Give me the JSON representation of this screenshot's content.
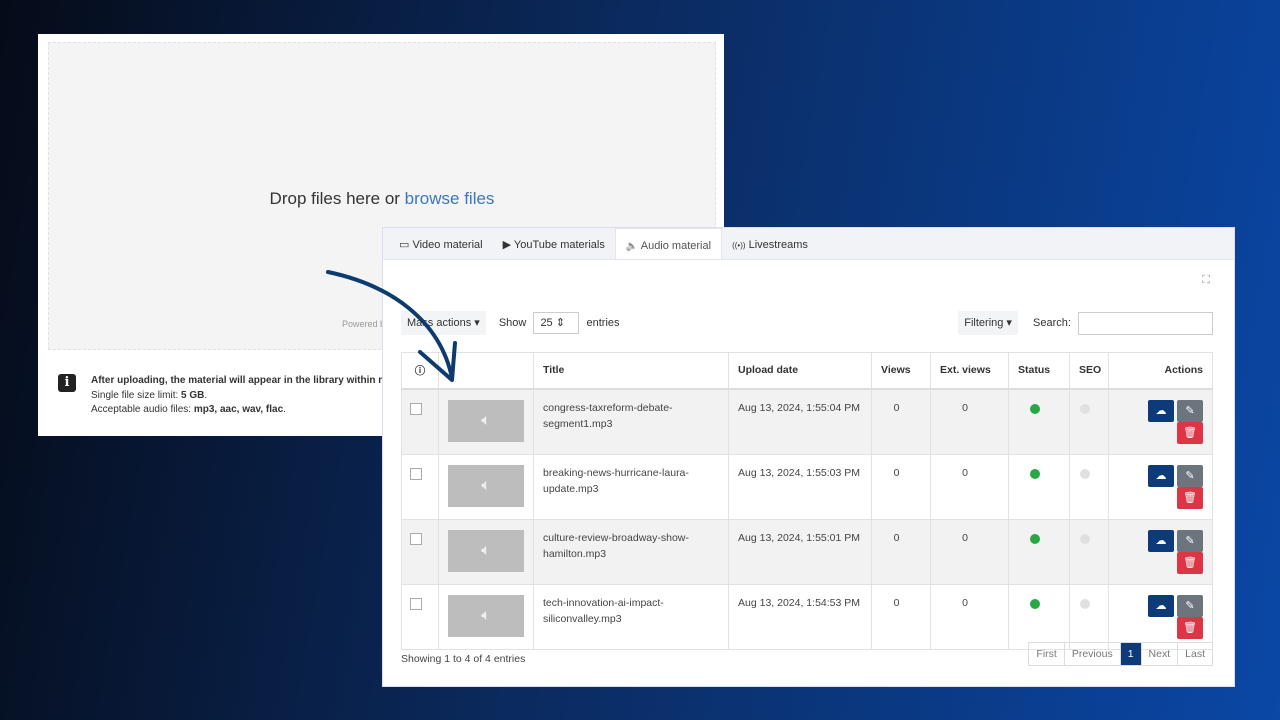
{
  "upload": {
    "drop_text": "Drop files here or ",
    "browse_link": "browse files",
    "powered": "Powered b",
    "info_title": "After uploading, the material will appear in the library within m",
    "size_label": "Single file size limit: ",
    "size_value": "5 GB",
    "size_end": ".",
    "types_label": "Acceptable audio files: ",
    "types_value": "mp3, aac, wav, flac",
    "types_end": "."
  },
  "tabs": [
    {
      "icon": "▭",
      "label": "Video material"
    },
    {
      "icon": "▶",
      "label": "YouTube materials"
    },
    {
      "icon": "🔈",
      "label": "Audio material"
    },
    {
      "icon": "((•))",
      "label": "Livestreams"
    }
  ],
  "toolbar": {
    "mass_actions": "Mass actions ▾",
    "show": "Show",
    "entries_value": "25",
    "entries": "entries",
    "filtering": "Filtering ▾",
    "search": "Search:"
  },
  "table": {
    "headers": [
      "",
      "",
      "Title",
      "Upload date",
      "Views",
      "Ext. views",
      "Status",
      "SEO",
      "Actions"
    ],
    "rows": [
      {
        "title": "congress-taxreform-debate-segment1.mp3",
        "date": "Aug 13, 2024, 1:55:04 PM",
        "views": "0",
        "ext": "0"
      },
      {
        "title": "breaking-news-hurricane-laura-update.mp3",
        "date": "Aug 13, 2024, 1:55:03 PM",
        "views": "0",
        "ext": "0"
      },
      {
        "title": "culture-review-broadway-show-hamilton.mp3",
        "date": "Aug 13, 2024, 1:55:01 PM",
        "views": "0",
        "ext": "0"
      },
      {
        "title": "tech-innovation-ai-impact-siliconvalley.mp3",
        "date": "Aug 13, 2024, 1:54:53 PM",
        "views": "0",
        "ext": "0"
      }
    ]
  },
  "footer": {
    "showing": "Showing 1 to 4 of 4 entries",
    "pager": [
      "First",
      "Previous",
      "1",
      "Next",
      "Last"
    ]
  },
  "colors": {
    "status_active": "#28a745",
    "seo_inactive": "#e0e0e0",
    "download": "#0d3b7a",
    "edit": "#6c757d",
    "delete": "#dc3545",
    "arrow": "#0d3b6e"
  }
}
